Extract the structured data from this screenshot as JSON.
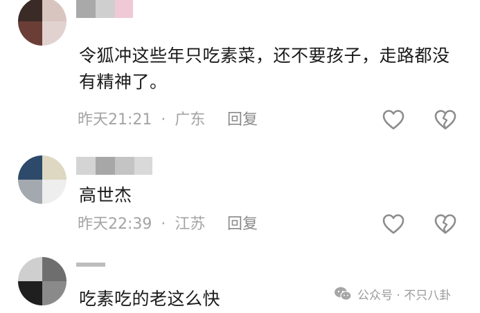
{
  "comments": [
    {
      "text": "令狐冲这些年只吃素菜，还不要孩子，走路都没有精神了。",
      "time": "昨天21:21",
      "separator": "·",
      "location": "广东",
      "reply_label": "回复",
      "like_icon": "heart-outline-icon",
      "dislike_icon": "broken-heart-icon"
    },
    {
      "text": "高世杰",
      "time": "昨天22:39",
      "separator": "·",
      "location": "江苏",
      "reply_label": "回复",
      "like_icon": "heart-outline-icon",
      "dislike_icon": "broken-heart-icon"
    },
    {
      "text": "吃素吃的老这么快"
    }
  ],
  "watermark": {
    "icon": "wechat-logo-icon",
    "text": "公众号 · 不只八卦"
  },
  "colors": {
    "text": "#1a1a1a",
    "meta": "#a3a3a3",
    "icon": "#8c8c8c"
  }
}
